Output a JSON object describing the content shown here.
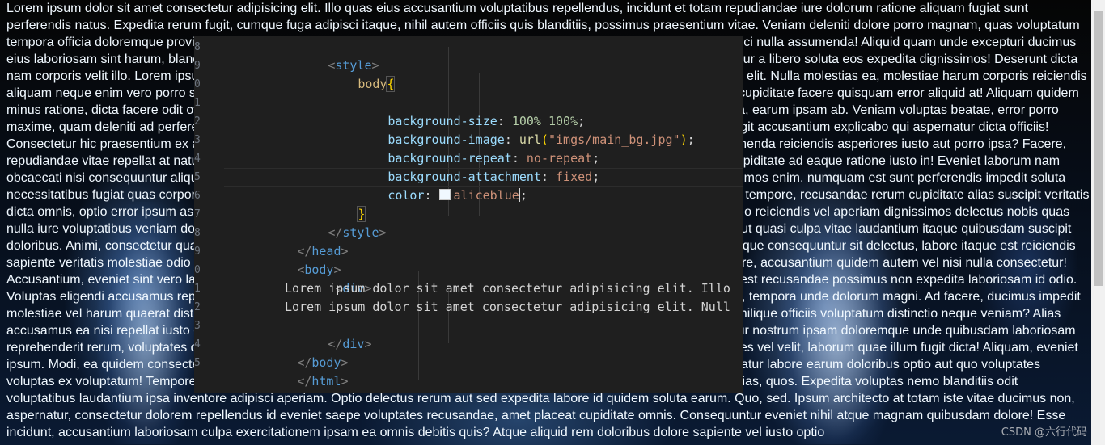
{
  "page_text": "Lorem ipsum dolor sit amet consectetur adipisicing elit. Illo quas eius accusantium voluptatibus repellendus, incidunt et totam repudiandae iure dolorum ratione aliquam fugiat sunt perferendis natus. Expedita rerum fugit, cumque fuga adipisci itaque, nihil autem officiis quis blanditiis, possimus praesentium vitae. Veniam deleniti dolore porro magnam, quas voluptatum tempora officia doloremque provident excepturi delectus ipsam nihil modi ut aperiam amet ratione ipsa explicabo ad ipsum adipisci nulla assumenda! Aliquid quam unde excepturi ducimus eius laboriosam sint harum, blanditiis ab rem deserunt cupiditate vitae deleniti hic pariatur reiciendis sint molestias eligendi pariatur a libero soluta eos expedita dignissimos! Deserunt dicta nam corporis velit illo. Lorem ipsum dolor sit amet consectetur adipisicing elit. Lorem ipsum dolor sit amet consectetur adipisicing elit. Nulla molestias ea, molestiae harum corporis reiciendis aliquam neque enim vero porro sapiente maxime omnis eaque vel voluptatibus quam ipsam officia odio nisi cupiditate excepturi cupiditate facere quisquam error aliquid at! Aliquam quidem minus ratione, dicta facere odit officiis dolores voluptas in eius beatae ab nam repellendus veritatis tempore sit tempore rem nulla, earum ipsam ab. Veniam voluptas beatae, error porro maxime, quam deleniti ad perferendis eligendi reprehenderit placeat molestias dolorum cum repudiandae iusto, nam distinctio fugit accusantium explicabo qui aspernatur dicta officiis! Consectetur hic praesentium ex animi esse eos ipsa maxime assumenda ullam repellat fuga alias repellendus dolore velit, assumenda reiciendis asperiores iusto aut porro ipsa? Facere, repudiandae vitae repellat at natus neque reiciendis sapiente, aperiam minima deleniti dicta corrupti voluptas enim aspernatur cupiditate ad eaque ratione iusto in! Eveniet laborum nam obcaecati nisi consequuntur aliquid ab quos laborum corporis necessitatibus quae reprehenderit, dolorem quam tempora dignissimos enim, numquam est sunt perferendis impedit soluta necessitatibus fugiat quas corporis facere illum architecto ut odit debitis assumenda obcaecati repellat voluptas iure saepe nemo tempore, recusandae rerum cupiditate alias suscipit veritatis dicta omnis, optio error ipsum aspernatur magnam laboriosam totam facilis eius exercitationem numquam adipisci nihil officiis odio reiciendis vel aperiam dignissimos delectus nobis quas nulla iure voluptatibus veniam dolores repellat nesciunt iste quae nam pariatur qui ex voluptatem recusandae dolorem amet non ut quasi culpa vitae laudantium itaque quibusdam suscipit doloribus. Animi, consectetur quae iusto voluptatum fugiat eum cum quod laudantium odit a nostrum harum reprehenderit odio atque consequuntur sit delectus, labore itaque est reiciendis sapiente veritatis molestiae odio tempora incidunt dicta est ut qui, iusto fugit porro vero eaque cupiditate voluptatem ullam tempore, accusantium quidem autem vel nisi nulla consectetur! Accusantium, eveniet sint vero laboriosam molestiae voluptatem adipisci aliquam nemo rem, ipsam sed odio eum nostrum vitae est recusandae possimus non expedita laboriosam id odio. Voluptas eligendi accusamus repellendus, animi aperiam sequi provident illum consequatur nulla veritatis eum distinctio ipsa iste, tempora unde dolorum magni. Ad facere, ducimus impedit molestiae vel harum quaerat distinctio quisquam odio sed dolorem repellendus accusamus aperiam corrupti officiis, neque ad similique officiis voluptatum distinctio neque veniam? Alias accusamus ea nisi repellat iusto dolorem soluta cupiditate libero natus ipsum perferendis praesentium impedit aliquam aspernatur nostrum ipsam doloremque unde quibusdam laboriosam reprehenderit rerum, voluptates quis autem ipsam quaerat tempora nobis voluptatum facere officiis voluptas minus eum ab dolores vel velit, laborum quae illum fugit dicta! Aliquam, eveniet ipsum. Modi, ea quidem consectetur hic eaque velit laboriosam corporis perferendis aut ratione nemo rerum itaque quas, aspernatur labore earum doloribus optio aut quo voluptates voluptas ex voluptatum! Tempore enim repudiandae autem facilis eaque reprehenderit inventore cum molestiae corporis nemo alias, quos. Expedita voluptas nemo blanditiis odit voluptatibus laudantium ipsa inventore adipisci aperiam. Optio delectus rerum aut sed expedita labore id quidem soluta earum. Quo, sed. Ipsum architecto at totam iste vitae ducimus non, aspernatur, consectetur dolorem repellendus id eveniet saepe voluptates recusandae, amet placeat cupiditate omnis. Consequuntur eveniet nihil atque magnam quibusdam dolore! Esse incidunt, accusantium laboriosam culpa exercitationem ipsam ea omnis debitis quis? Atque aliquid rem doloribus dolore sapiente vel iusto optio",
  "editor": {
    "line_numbers": [
      "8",
      "9",
      "0",
      "1",
      "2",
      "3",
      "4",
      "5",
      "6",
      "7",
      "8",
      "9",
      "0",
      "1",
      "2",
      "3",
      "4",
      "5"
    ],
    "lines": {
      "style_open": {
        "b1": "<",
        "tag": "style",
        "b2": ">"
      },
      "body_sel": {
        "sel": "body",
        "brace": "{"
      },
      "bg_size": {
        "prop": "background-size",
        "colon": ": ",
        "v1": "100%",
        "sp": " ",
        "v2": "100%",
        "semi": ";"
      },
      "bg_image": {
        "prop": "background-image",
        "colon": ": ",
        "fn": "url",
        "p1": "(",
        "str": "\"imgs/main_bg.jpg\"",
        "p2": ")",
        "semi": ";"
      },
      "bg_repeat": {
        "prop": "background-repeat",
        "colon": ": ",
        "val": "no-repeat",
        "semi": ";"
      },
      "bg_attach": {
        "prop": "background-attachment",
        "colon": ": ",
        "val": "fixed",
        "semi": ";"
      },
      "color": {
        "prop": "color",
        "colon": ": ",
        "val": "aliceblue",
        "semi": ";"
      },
      "brace_close": "}",
      "style_close": {
        "b1": "</",
        "tag": "style",
        "b2": ">"
      },
      "head_close": {
        "b1": "</",
        "tag": "head",
        "b2": ">"
      },
      "body_open": {
        "b1": "<",
        "tag": "body",
        "b2": ">"
      },
      "div_open": {
        "b1": "<",
        "tag": "div",
        "b2": ">"
      },
      "text1": "Lorem ipsum dolor sit amet consectetur adipisicing elit. Illo",
      "text2": "Lorem ipsum dolor sit amet consectetur adipisicing elit. Null",
      "div_close": {
        "b1": "</",
        "tag": "div",
        "b2": ">"
      },
      "body_close": {
        "b1": "</",
        "tag": "body",
        "b2": ">"
      },
      "html_close": {
        "b1": "</",
        "tag": "html",
        "b2": ">"
      }
    },
    "swatch_color": "#f0f8ff"
  },
  "watermark": "CSDN @六行代码",
  "colors": {
    "text": "#f0f8ff",
    "editor_bg": "#1f1f1f",
    "tag": "#569cd6",
    "property": "#9cdcfe",
    "value": "#ce9178",
    "number": "#b5cea8",
    "function": "#dcdcaa",
    "selector": "#d7ba7d"
  }
}
